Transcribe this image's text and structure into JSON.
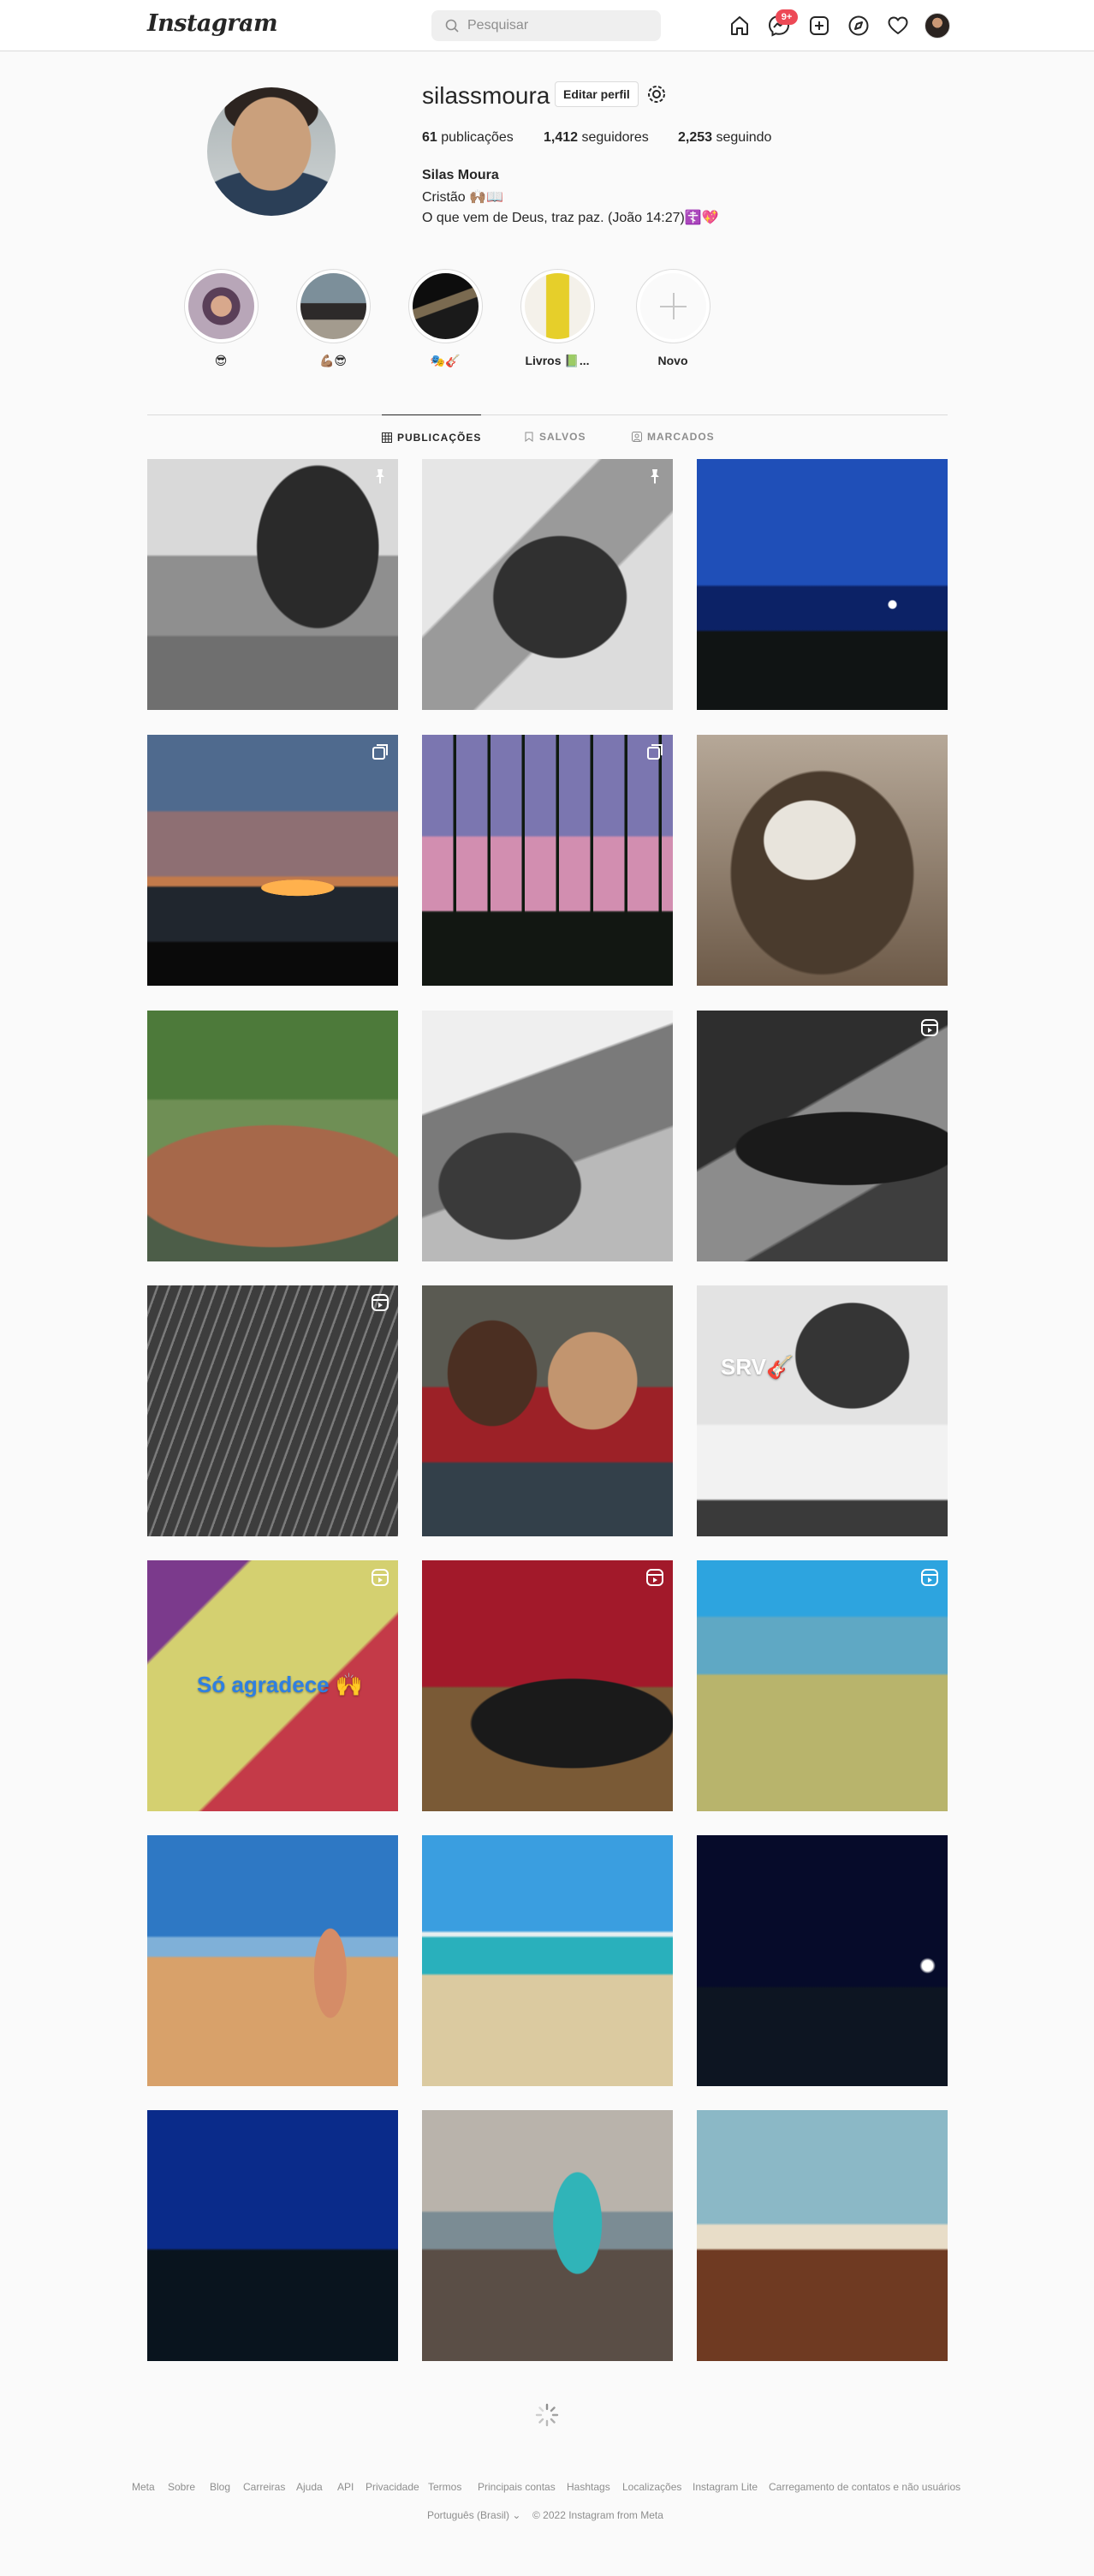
{
  "nav": {
    "logo": "Instagram",
    "search_placeholder": "Pesquisar",
    "notification_badge": "9+",
    "icons": [
      "home-icon",
      "messenger-icon",
      "new-post-icon",
      "explore-icon",
      "activity-heart-icon",
      "profile-avatar"
    ]
  },
  "profile": {
    "username": "silassmoura",
    "edit_label": "Editar perfil",
    "posts_count": "61",
    "posts_label": "publicações",
    "followers_count": "1,412",
    "followers_label": "seguidores",
    "following_count": "2,253",
    "following_label": "seguindo",
    "full_name": "Silas Moura",
    "bio_line1": "Cristão 🙌🏽📖",
    "bio_line2": "O que vem de Deus, traz paz. (João 14:27)☦️💖"
  },
  "highlights": [
    {
      "label": "😎"
    },
    {
      "label": "💪🏽😎"
    },
    {
      "label": "🎭🎸"
    },
    {
      "label": "Livros 📗..."
    },
    {
      "label": "Novo"
    }
  ],
  "tabs": [
    {
      "label": "PUBLICAÇÕES",
      "active": true
    },
    {
      "label": "SALVOS",
      "active": false
    },
    {
      "label": "MARCADOS",
      "active": false
    }
  ],
  "posts": [
    {
      "overlay": "pin-icon",
      "overlay_text": ""
    },
    {
      "overlay": "pin-icon",
      "overlay_text": ""
    },
    {
      "overlay": "",
      "overlay_text": ""
    },
    {
      "overlay": "carousel-icon",
      "overlay_text": ""
    },
    {
      "overlay": "carousel-icon",
      "overlay_text": ""
    },
    {
      "overlay": "",
      "overlay_text": ""
    },
    {
      "overlay": "",
      "overlay_text": ""
    },
    {
      "overlay": "",
      "overlay_text": ""
    },
    {
      "overlay": "reel-icon",
      "overlay_text": ""
    },
    {
      "overlay": "reel-icon",
      "overlay_text": ""
    },
    {
      "overlay": "",
      "overlay_text": ""
    },
    {
      "overlay": "",
      "overlay_text": "SRV🎸"
    },
    {
      "overlay": "reel-icon",
      "overlay_text": "Só agradece 🙌"
    },
    {
      "overlay": "reel-icon",
      "overlay_text": ""
    },
    {
      "overlay": "reel-icon",
      "overlay_text": ""
    },
    {
      "overlay": "",
      "overlay_text": ""
    },
    {
      "overlay": "",
      "overlay_text": ""
    },
    {
      "overlay": "",
      "overlay_text": ""
    },
    {
      "overlay": "",
      "overlay_text": ""
    },
    {
      "overlay": "",
      "overlay_text": ""
    },
    {
      "overlay": "",
      "overlay_text": ""
    }
  ],
  "footer": {
    "links": [
      "Meta",
      "Sobre",
      "Blog",
      "Carreiras",
      "Ajuda",
      "API",
      "Privacidade",
      "Termos",
      "Principais contas",
      "Hashtags",
      "Localizações",
      "Instagram Lite",
      "Carregamento de contatos e não usuários"
    ],
    "language": "Português (Brasil)",
    "copyright": "© 2022 Instagram from Meta"
  }
}
